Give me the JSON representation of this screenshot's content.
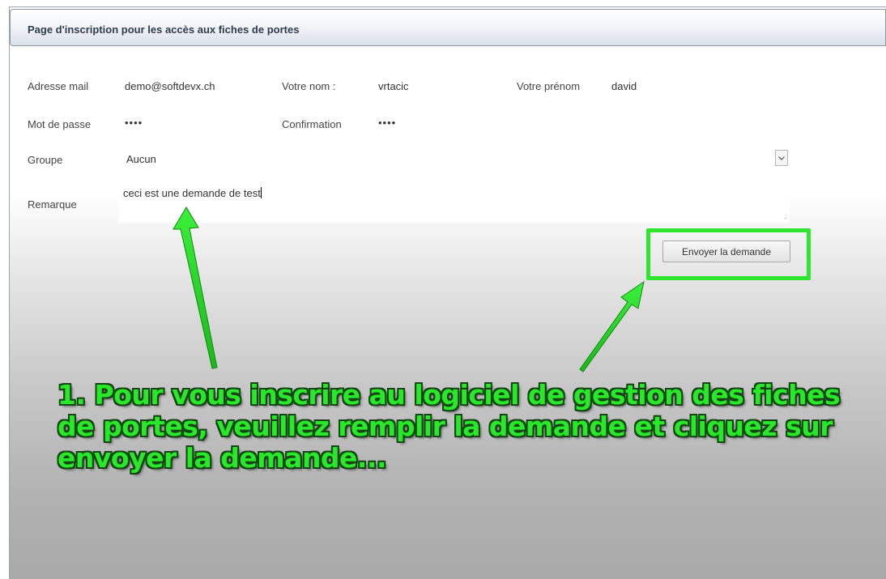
{
  "header": {
    "title": "Page d'inscription pour les accès aux fiches de portes"
  },
  "form": {
    "email_label": "Adresse mail",
    "email_value": "demo@softdevx.ch",
    "name_label": "Votre nom :",
    "name_value": "vrtacic",
    "firstname_label": "Votre prénom",
    "firstname_value": "david",
    "password_label": "Mot de passe",
    "password_mask": "••••",
    "confirm_label": "Confirmation",
    "confirm_mask": "••••",
    "group_label": "Groupe",
    "group_selected": "Aucun",
    "remark_label": "Remarque",
    "remark_value": "ceci est une demande de test",
    "submit_label": "Envoyer la demande"
  },
  "annotation": {
    "text": "1. Pour vous inscrire au logiciel de gestion des fiches de portes, veuillez remplir la demande et cliquez sur envoyer la demande..."
  },
  "colors": {
    "annotation_green": "#29e729",
    "highlight_green": "#2ee62e",
    "header_text": "#2f3c4e"
  }
}
